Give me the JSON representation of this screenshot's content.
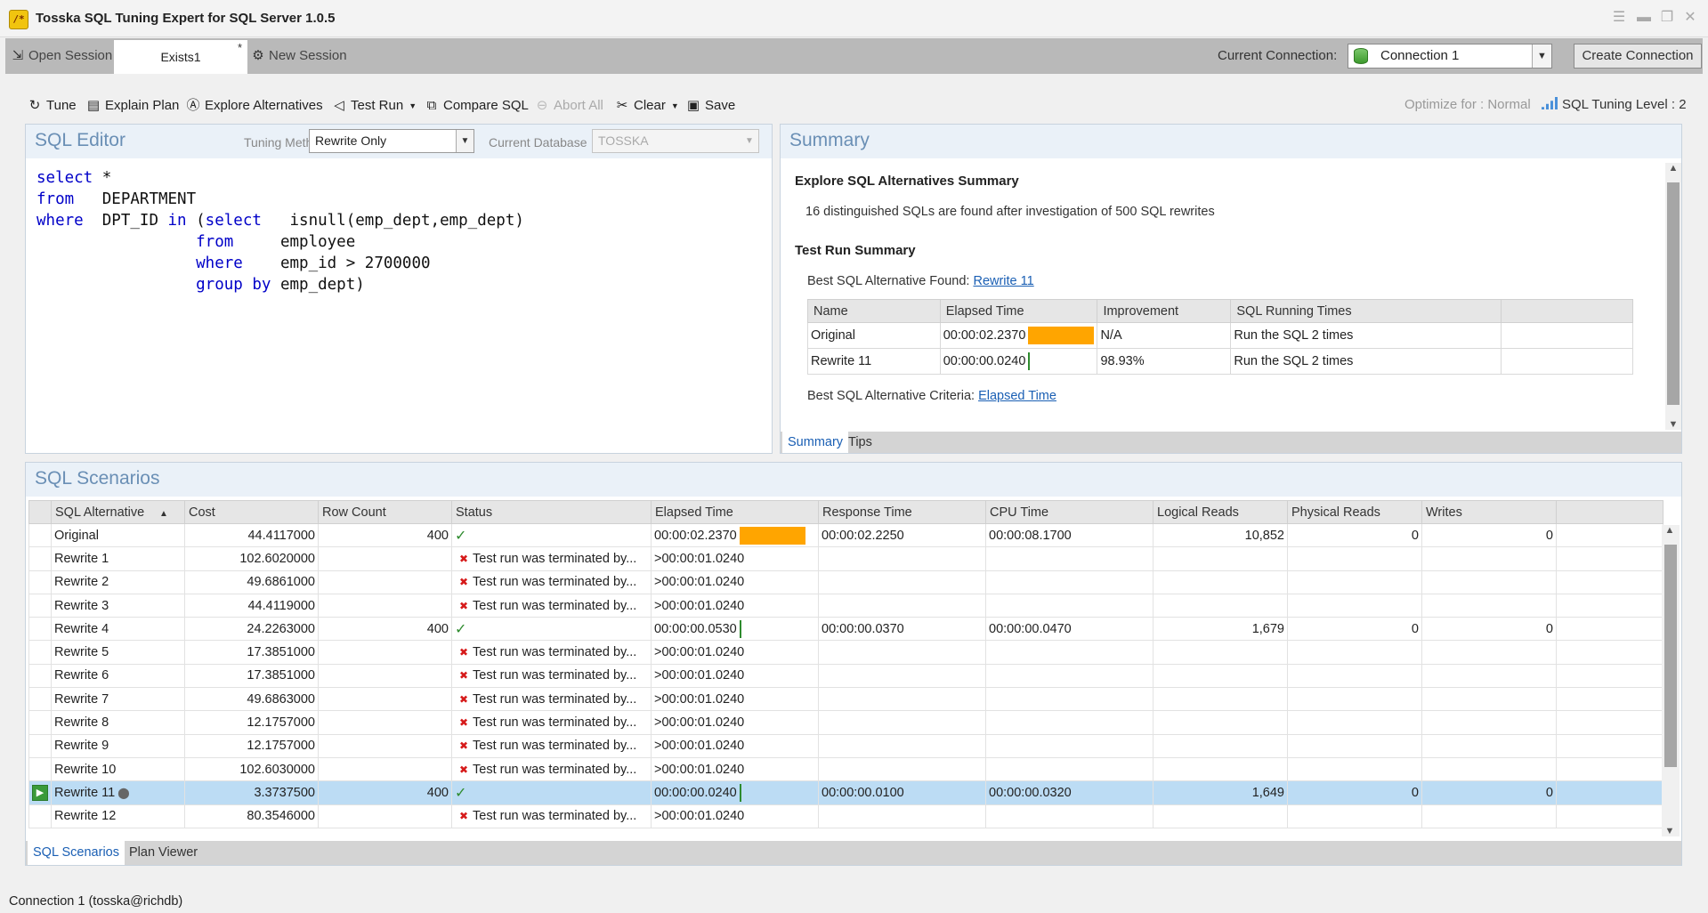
{
  "window": {
    "title": "Tosska SQL Tuning Expert for SQL Server 1.0.5",
    "icon_text": "/*"
  },
  "session_tabs": {
    "open_session": "Open Session",
    "active_tab": "Exists1",
    "active_modified": "*",
    "new_session": "New Session"
  },
  "connection": {
    "label": "Current Connection:",
    "selected": "Connection 1",
    "create_button": "Create Connection"
  },
  "toolbar": {
    "tune": "Tune",
    "explain_plan": "Explain Plan",
    "explore_alternatives": "Explore Alternatives",
    "test_run": "Test Run",
    "compare_sql": "Compare SQL",
    "abort_all": "Abort All",
    "clear": "Clear",
    "save": "Save",
    "optimize_for": "Optimize for : Normal",
    "tuning_level": "SQL Tuning Level : 2"
  },
  "sql_editor": {
    "title": "SQL Editor",
    "tuning_method_label": "Tuning Method",
    "tuning_method": "Rewrite Only",
    "current_database_label": "Current Database",
    "current_database": "TOSSKA"
  },
  "summary": {
    "title": "Summary",
    "explore_heading": "Explore SQL Alternatives Summary",
    "explore_text": "16 distinguished SQLs are found after investigation of 500 SQL rewrites",
    "testrun_heading": "Test Run Summary",
    "best_found_label": "Best SQL Alternative Found:",
    "best_found_link": "Rewrite 11",
    "columns": [
      "Name",
      "Elapsed Time",
      "Improvement",
      "SQL Running Times"
    ],
    "rows": [
      {
        "name": "Original",
        "elapsed": "00:00:02.2370",
        "improvement": "N/A",
        "running": "Run the SQL 2  times",
        "ratio": 1.0
      },
      {
        "name": "Rewrite 11",
        "elapsed": "00:00:00.0240",
        "improvement": "98.93%",
        "running": "Run the SQL 2  times",
        "ratio": 0.0107
      }
    ],
    "criteria_label": "Best SQL Alternative Criteria:",
    "criteria_link": "Elapsed Time",
    "tabs": [
      "Summary",
      "Tips"
    ]
  },
  "scenarios": {
    "title": "SQL Scenarios",
    "columns": [
      "SQL Alternative",
      "Cost",
      "Row Count",
      "Status",
      "Elapsed Time",
      "Response Time",
      "CPU Time",
      "Logical Reads",
      "Physical Reads",
      "Writes"
    ],
    "rows": [
      {
        "name": "Original",
        "cost": "44.4117000",
        "rows": "400",
        "status": "ok",
        "message": "",
        "elapsed": "00:00:02.2370",
        "ratio": 1.0,
        "response": "00:00:02.2250",
        "cpu": "00:00:08.1700",
        "logical": "10,852",
        "physical": "0",
        "writes": "0"
      },
      {
        "name": "Rewrite 1",
        "cost": "102.6020000",
        "rows": "",
        "status": "error",
        "message": "Test run was terminated by...",
        "elapsed": ">00:00:01.0240",
        "ratio": null,
        "response": "",
        "cpu": "",
        "logical": "",
        "physical": "",
        "writes": ""
      },
      {
        "name": "Rewrite 2",
        "cost": "49.6861000",
        "rows": "",
        "status": "error",
        "message": "Test run was terminated by...",
        "elapsed": ">00:00:01.0240",
        "ratio": null,
        "response": "",
        "cpu": "",
        "logical": "",
        "physical": "",
        "writes": ""
      },
      {
        "name": "Rewrite 3",
        "cost": "44.4119000",
        "rows": "",
        "status": "error",
        "message": "Test run was terminated by...",
        "elapsed": ">00:00:01.0240",
        "ratio": null,
        "response": "",
        "cpu": "",
        "logical": "",
        "physical": "",
        "writes": ""
      },
      {
        "name": "Rewrite 4",
        "cost": "24.2263000",
        "rows": "400",
        "status": "ok",
        "message": "",
        "elapsed": "00:00:00.0530",
        "ratio": 0.0237,
        "response": "00:00:00.0370",
        "cpu": "00:00:00.0470",
        "logical": "1,679",
        "physical": "0",
        "writes": "0"
      },
      {
        "name": "Rewrite 5",
        "cost": "17.3851000",
        "rows": "",
        "status": "error",
        "message": "Test run was terminated by...",
        "elapsed": ">00:00:01.0240",
        "ratio": null,
        "response": "",
        "cpu": "",
        "logical": "",
        "physical": "",
        "writes": ""
      },
      {
        "name": "Rewrite 6",
        "cost": "17.3851000",
        "rows": "",
        "status": "error",
        "message": "Test run was terminated by...",
        "elapsed": ">00:00:01.0240",
        "ratio": null,
        "response": "",
        "cpu": "",
        "logical": "",
        "physical": "",
        "writes": ""
      },
      {
        "name": "Rewrite 7",
        "cost": "49.6863000",
        "rows": "",
        "status": "error",
        "message": "Test run was terminated by...",
        "elapsed": ">00:00:01.0240",
        "ratio": null,
        "response": "",
        "cpu": "",
        "logical": "",
        "physical": "",
        "writes": ""
      },
      {
        "name": "Rewrite 8",
        "cost": "12.1757000",
        "rows": "",
        "status": "error",
        "message": "Test run was terminated by...",
        "elapsed": ">00:00:01.0240",
        "ratio": null,
        "response": "",
        "cpu": "",
        "logical": "",
        "physical": "",
        "writes": ""
      },
      {
        "name": "Rewrite 9",
        "cost": "12.1757000",
        "rows": "",
        "status": "error",
        "message": "Test run was terminated by...",
        "elapsed": ">00:00:01.0240",
        "ratio": null,
        "response": "",
        "cpu": "",
        "logical": "",
        "physical": "",
        "writes": ""
      },
      {
        "name": "Rewrite 10",
        "cost": "102.6030000",
        "rows": "",
        "status": "error",
        "message": "Test run was terminated by...",
        "elapsed": ">00:00:01.0240",
        "ratio": null,
        "response": "",
        "cpu": "",
        "logical": "",
        "physical": "",
        "writes": ""
      },
      {
        "name": "Rewrite 11",
        "cost": "3.3737500",
        "rows": "400",
        "status": "ok",
        "message": "",
        "elapsed": "00:00:00.0240",
        "ratio": 0.0107,
        "response": "00:00:00.0100",
        "cpu": "00:00:00.0320",
        "logical": "1,649",
        "physical": "0",
        "writes": "0",
        "selected": true
      },
      {
        "name": "Rewrite 12",
        "cost": "80.3546000",
        "rows": "",
        "status": "error",
        "message": "Test run was terminated by...",
        "elapsed": ">00:00:01.0240",
        "ratio": null,
        "response": "",
        "cpu": "",
        "logical": "",
        "physical": "",
        "writes": ""
      }
    ],
    "tabs": [
      "SQL Scenarios",
      "Plan Viewer"
    ]
  },
  "status_bar": "Connection 1 (tosska@richdb)",
  "colors": {
    "accent": "#1a5fb4",
    "bar": "#ffa500",
    "bar_short": "#2e8b2e",
    "selected_row": "#bcdcf4"
  }
}
